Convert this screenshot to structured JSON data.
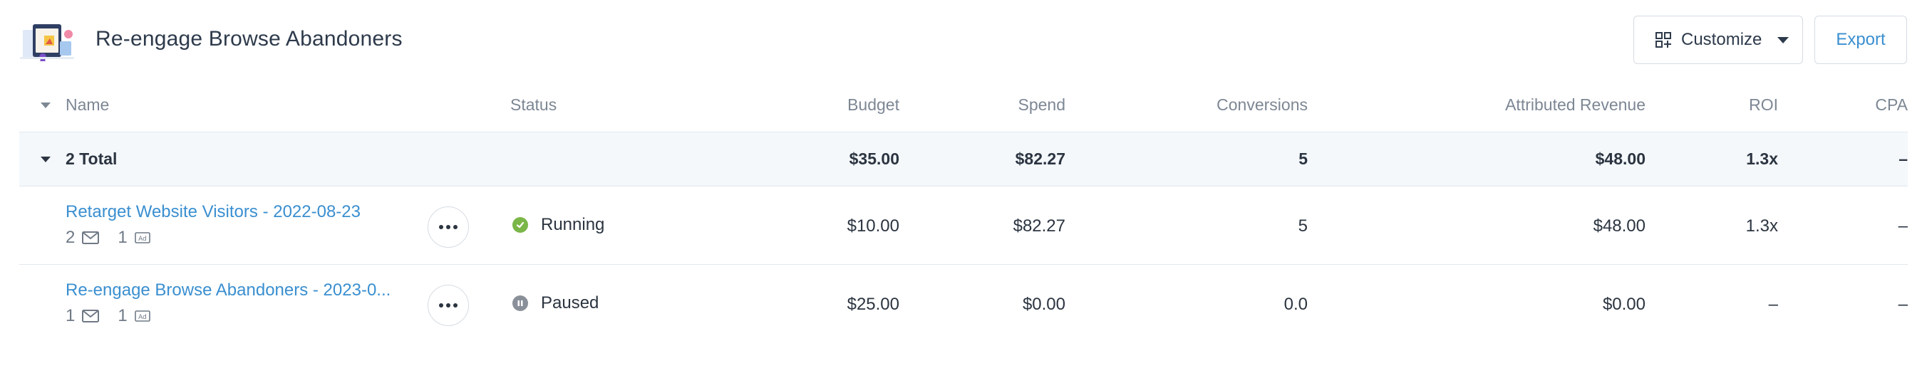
{
  "header": {
    "title": "Re-engage Browse Abandoners",
    "customize_label": "Customize",
    "export_label": "Export"
  },
  "columns": {
    "name": "Name",
    "status": "Status",
    "budget": "Budget",
    "spend": "Spend",
    "conversions": "Conversions",
    "attributed_revenue": "Attributed Revenue",
    "roi": "ROI",
    "cpa": "CPA"
  },
  "total": {
    "label": "2 Total",
    "budget": "$35.00",
    "spend": "$82.27",
    "conversions": "5",
    "attributed_revenue": "$48.00",
    "roi": "1.3x",
    "cpa": "–"
  },
  "rows": [
    {
      "name": "Retarget Website Visitors - 2022-08-23",
      "email_count": "2",
      "ad_count": "1",
      "status": "Running",
      "status_color": "#7ab648",
      "budget": "$10.00",
      "spend": "$82.27",
      "conversions": "5",
      "attributed_revenue": "$48.00",
      "roi": "1.3x",
      "cpa": "–"
    },
    {
      "name": "Re-engage Browse Abandoners - 2023-0...",
      "email_count": "1",
      "ad_count": "1",
      "status": "Paused",
      "status_color": "#8a9099",
      "budget": "$25.00",
      "spend": "$0.00",
      "conversions": "0.0",
      "attributed_revenue": "$0.00",
      "roi": "–",
      "cpa": "–"
    }
  ],
  "icons": {
    "logo": "campaign-illustration-icon",
    "customize": "grid-plus-icon",
    "dropdown": "caret-down-icon",
    "more": "more-dots-icon",
    "email": "mail-icon",
    "ad": "ad-icon",
    "running": "check-circle-icon",
    "paused": "pause-circle-icon"
  },
  "colors": {
    "accent": "#3a8fd0",
    "total_row_bg": "#f4f8fb",
    "running": "#7ab648",
    "paused": "#8a9099"
  }
}
